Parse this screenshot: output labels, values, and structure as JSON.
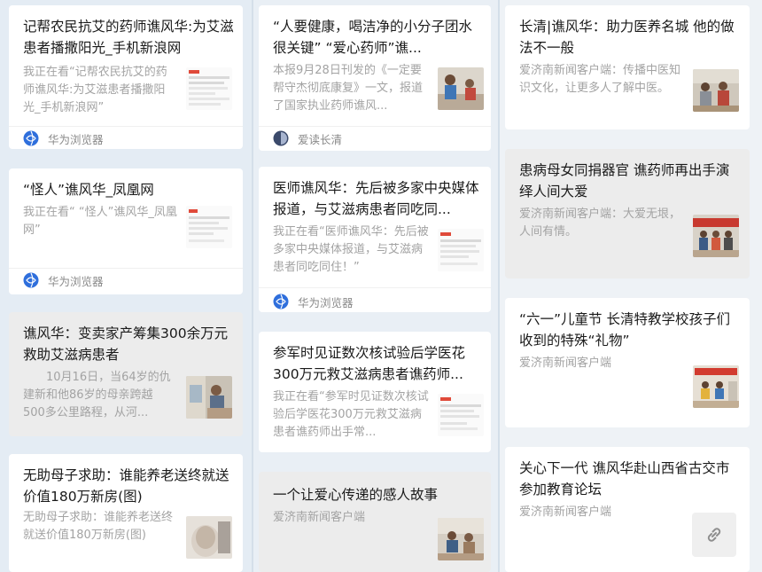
{
  "columns": [
    {
      "cards": [
        {
          "title": "记帮农民抗艾的药师谯风华:为艾滋患者播撒阳光_手机新浪网",
          "snippet": "我正在看“记帮农民抗艾的药师谯风华:为艾滋患者播撒阳光_手机新浪网”",
          "source": "华为浏览器",
          "source_icon": "globe-icon",
          "thumb": "news-page-thumbnail"
        },
        {
          "title": "“怪人”谯风华_凤凰网",
          "snippet": "我正在看“ “怪人”谯风华_凤凰网”",
          "source": "华为浏览器",
          "source_icon": "globe-icon",
          "thumb": "news-page-thumbnail"
        },
        {
          "title": "谯风华：变卖家产筹集300余万元救助艾滋病患者",
          "snippet": "10月16日，当64岁的仇建新和他86岁的母亲跨越500多公里路程，从河...",
          "thumb": "photo-thumbnail"
        },
        {
          "title": "无助母子求助：谁能养老送终就送价值180万新房(图)",
          "snippet": "无助母子求助：谁能养老送终 就送价值180万新房(图)",
          "thumb": "photo-thumbnail"
        }
      ]
    },
    {
      "cards": [
        {
          "title": "“人要健康，喝洁净的小分子团水很关键” “爱心药师”谯...",
          "snippet": "本报9月28日刊发的《一定要帮守杰彻底康复》一文，报道了国家执业药师谯风...",
          "source": "爱读长清",
          "source_icon": "app-avatar-icon",
          "thumb": "photo-thumbnail"
        },
        {
          "title": "医师谯风华：先后被多家中央媒体报道，与艾滋病患者同吃同...",
          "snippet": "我正在看“医师谯风华：先后被多家中央媒体报道，与艾滋病患者同吃同住！”",
          "source": "华为浏览器",
          "source_icon": "globe-icon",
          "thumb": "news-page-thumbnail"
        },
        {
          "title": "参军时见证数次核试验后学医花300万元救艾滋病患者谯药师...",
          "snippet": "我正在看“参军时见证数次核试验后学医花300万元救艾滋病患者谯药师出手常...",
          "thumb": "news-page-thumbnail"
        },
        {
          "title": "一个让爱心传递的感人故事",
          "snippet": "爱济南新闻客户端",
          "thumb": "photo-thumbnail"
        }
      ]
    },
    {
      "cards": [
        {
          "title": "长清|谯风华：助力医养名城 他的做法不一般",
          "snippet": "爱济南新闻客户端：传播中医知识文化，让更多人了解中医。",
          "thumb": "photo-thumbnail"
        },
        {
          "title": "患病母女同捐器官 谯药师再出手演绎人间大爱",
          "snippet": "爱济南新闻客户端：大爱无垠，人间有情。",
          "thumb": "photo-thumbnail"
        },
        {
          "title": "“六一”儿童节 长清特教学校孩子们收到的特殊“礼物”",
          "snippet": "爱济南新闻客户端",
          "thumb": "photo-thumbnail"
        },
        {
          "title": "关心下一代 谯风华赴山西省古交市参加教育论坛",
          "snippet": "爱济南新闻客户端",
          "thumb": "link-icon"
        }
      ]
    }
  ]
}
